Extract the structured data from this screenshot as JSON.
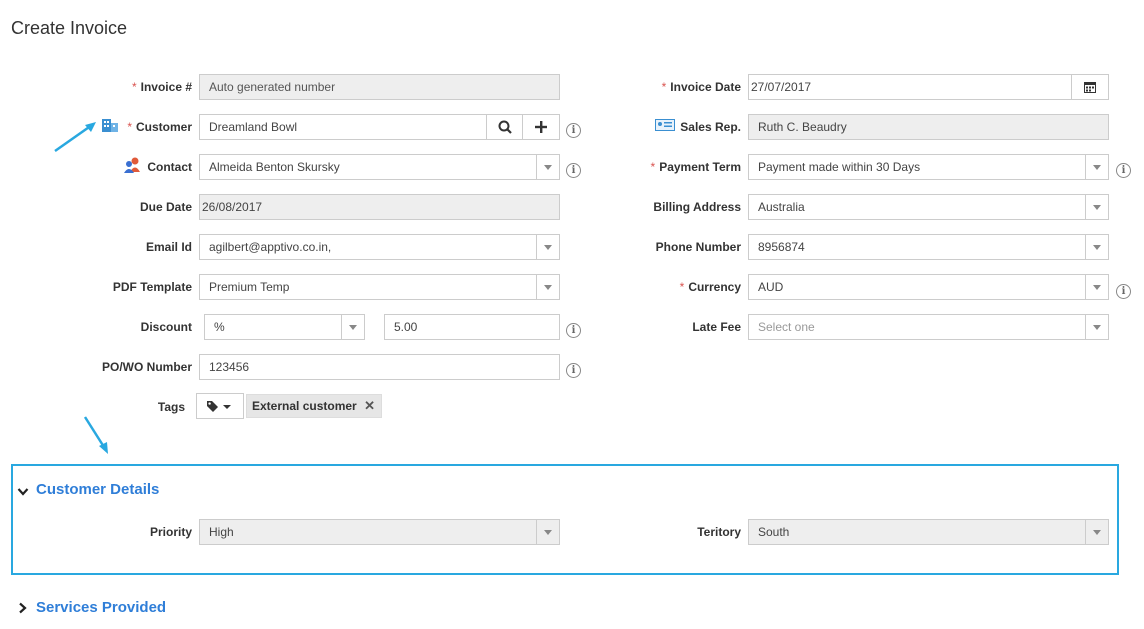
{
  "page_title": "Create Invoice",
  "left": {
    "invoice_no": {
      "label": "Invoice #",
      "placeholder": "Auto generated number"
    },
    "customer": {
      "label": "Customer",
      "value": "Dreamland Bowl"
    },
    "contact": {
      "label": "Contact",
      "value": "Almeida Benton Skursky"
    },
    "due_date": {
      "label": "Due Date",
      "value": "26/08/2017"
    },
    "email": {
      "label": "Email Id",
      "value": "agilbert@apptivo.co.in,"
    },
    "pdf_template": {
      "label": "PDF Template",
      "value": "Premium Temp"
    },
    "discount": {
      "label": "Discount",
      "type": "%",
      "value": "5.00"
    },
    "po_wo": {
      "label": "PO/WO Number",
      "value": "123456"
    },
    "tags": {
      "label": "Tags",
      "chip": "External customer"
    }
  },
  "right": {
    "invoice_date": {
      "label": "Invoice Date",
      "value": "27/07/2017"
    },
    "sales_rep": {
      "label": "Sales Rep.",
      "value": "Ruth C. Beaudry"
    },
    "payment_term": {
      "label": "Payment Term",
      "value": "Payment made within 30 Days"
    },
    "billing_address": {
      "label": "Billing Address",
      "value": "Australia"
    },
    "phone": {
      "label": "Phone Number",
      "value": "8956874"
    },
    "currency": {
      "label": "Currency",
      "value": "AUD"
    },
    "late_fee": {
      "label": "Late Fee",
      "placeholder": "Select one"
    }
  },
  "customer_details": {
    "title": "Customer Details",
    "priority": {
      "label": "Priority",
      "value": "High"
    },
    "territory": {
      "label": "Teritory",
      "value": "South"
    }
  },
  "services": {
    "title": "Services Provided"
  },
  "colors": {
    "accent": "#2f7ed8",
    "highlight": "#29a8e0",
    "required": "#d9534f"
  }
}
